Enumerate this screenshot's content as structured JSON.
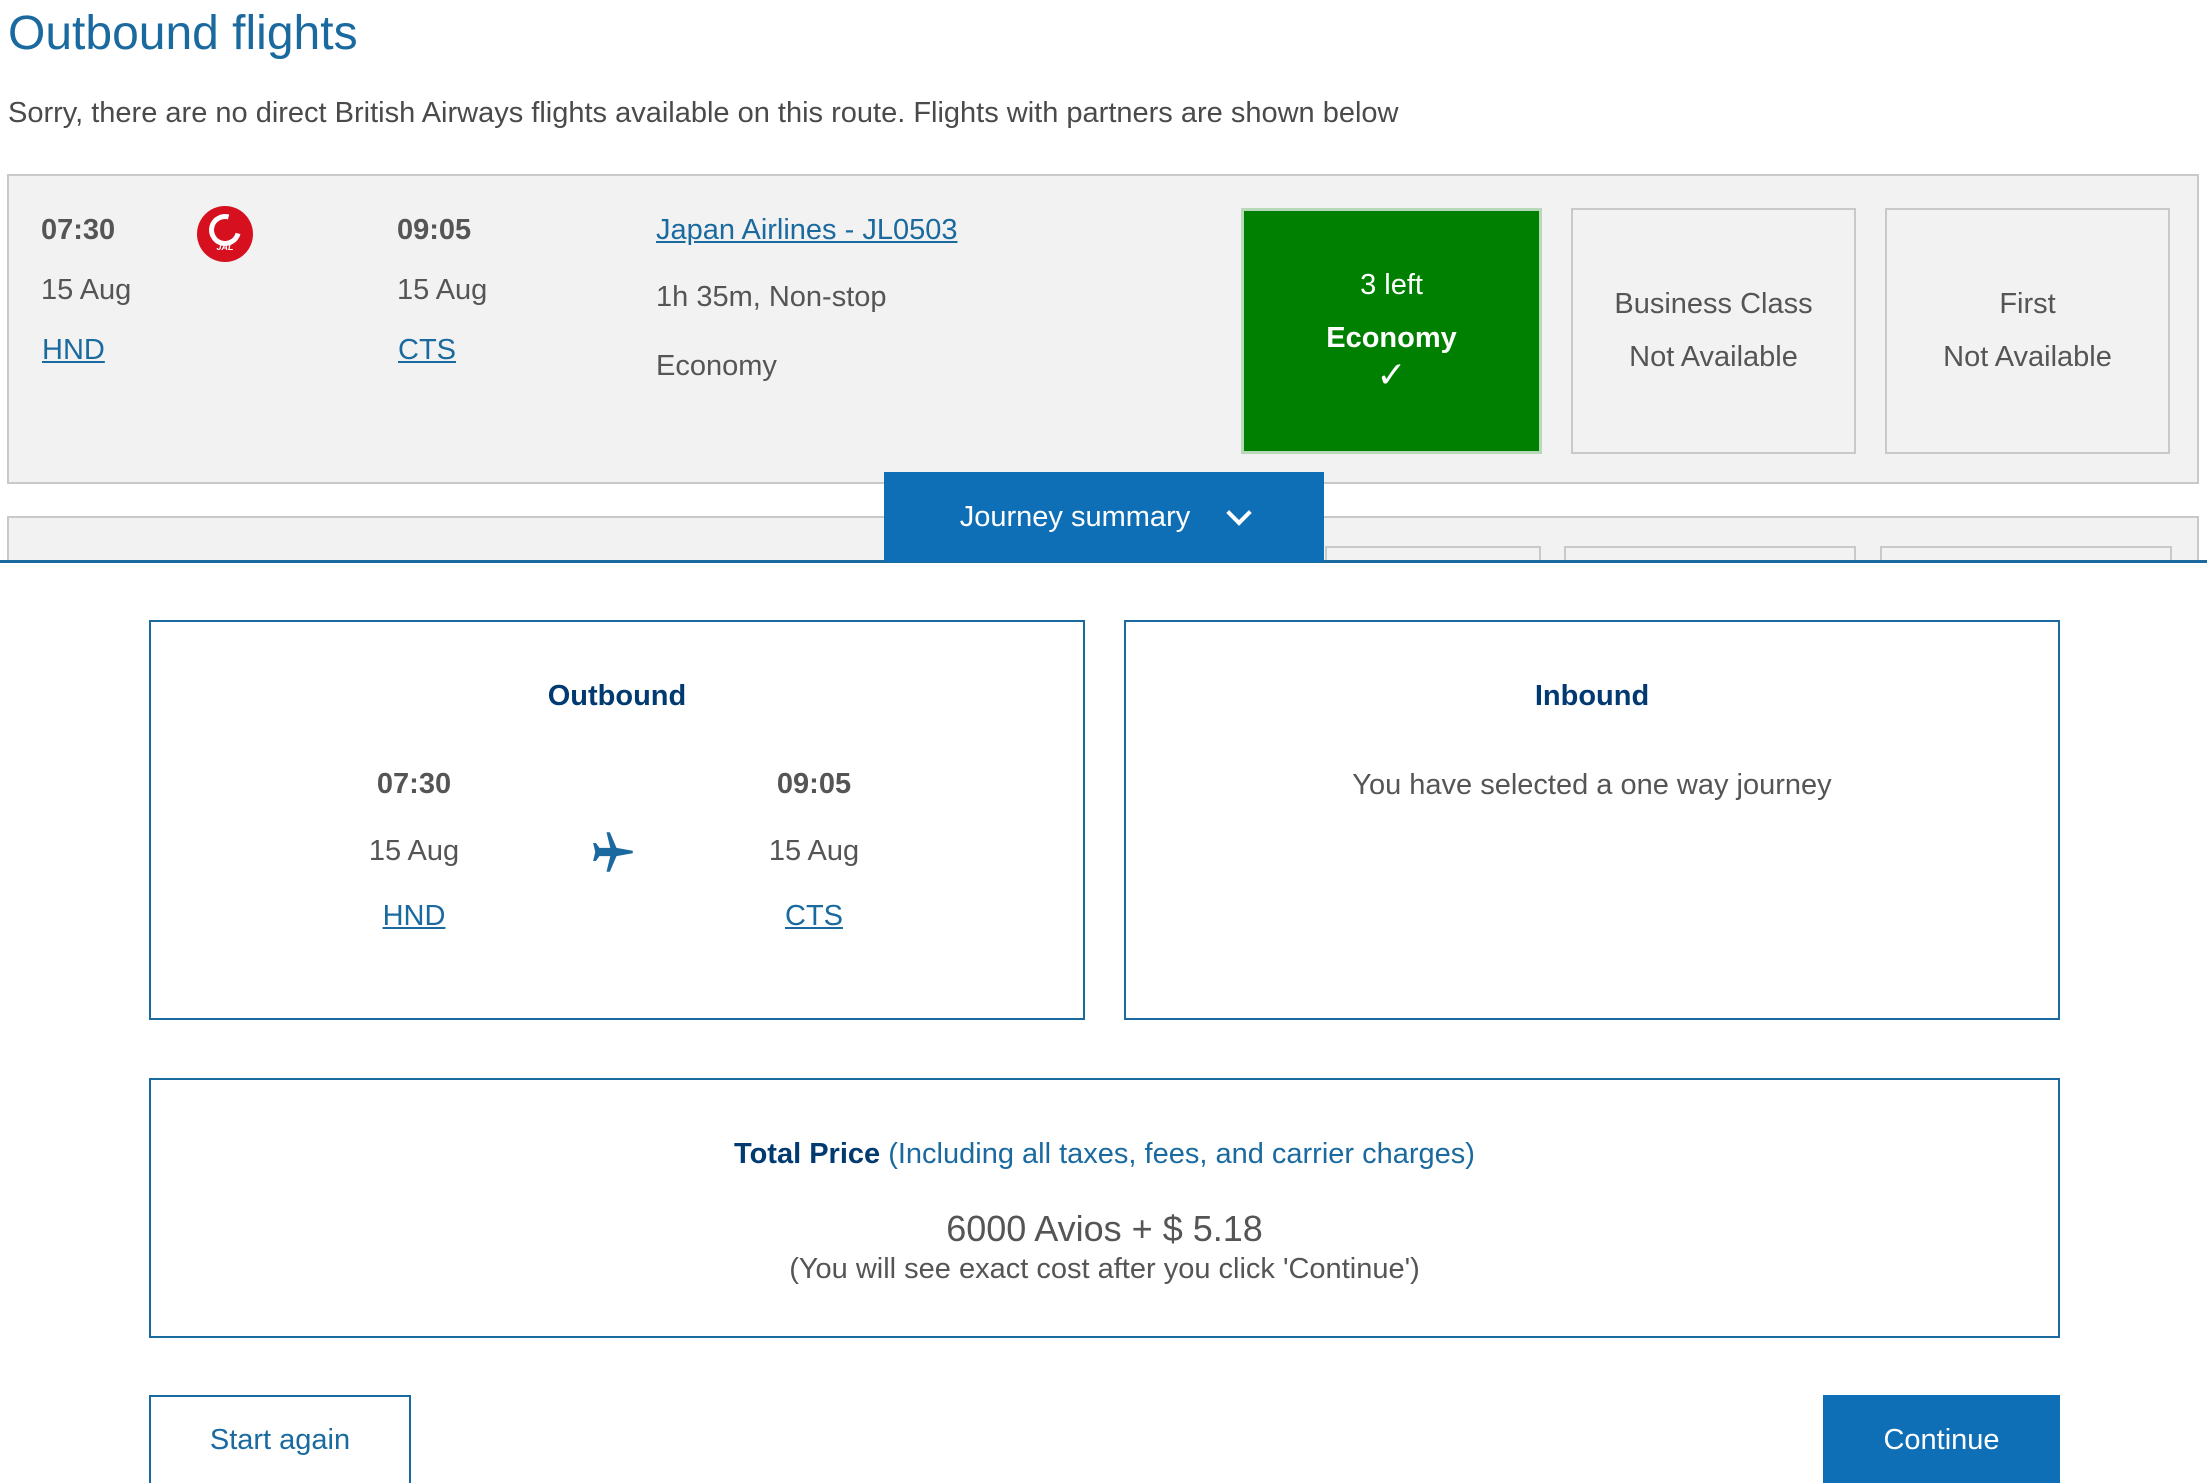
{
  "page": {
    "title": "Outbound flights",
    "notice": "Sorry, there are no direct British Airways flights available on this route. Flights with partners are shown below"
  },
  "flight": {
    "depart_time": "07:30",
    "depart_date": "15 Aug",
    "depart_airport": "HND",
    "arrive_time": "09:05",
    "arrive_date": "15 Aug",
    "arrive_airport": "CTS",
    "airline_link": "Japan Airlines - JL0503",
    "duration": "1h 35m, Non-stop",
    "cabin": "Economy",
    "airline_logo_text": "JAL",
    "economy": {
      "seats_left": "3 left",
      "label": "Economy",
      "check": "✓"
    },
    "business": {
      "label": "Business Class",
      "status": "Not Available"
    },
    "first": {
      "label": "First",
      "status": "Not Available"
    }
  },
  "summary_tab": {
    "label": "Journey summary"
  },
  "outbound": {
    "title": "Outbound",
    "depart_time": "07:30",
    "depart_date": "15 Aug",
    "depart_airport": "HND",
    "arrive_time": "09:05",
    "arrive_date": "15 Aug",
    "arrive_airport": "CTS"
  },
  "inbound": {
    "title": "Inbound",
    "message": "You have selected a one way journey"
  },
  "price": {
    "label": "Total Price",
    "qualifier": "(Including all taxes, fees, and carrier charges)",
    "amount": "6000 Avios + $ 5.18",
    "note": "(You will see exact cost after you click 'Continue')"
  },
  "buttons": {
    "start_again": "Start again",
    "continue": "Continue"
  },
  "colors": {
    "brand_blue": "#1a6aa0",
    "button_blue": "#0e6fb6",
    "selected_green": "#008000",
    "jal_red": "#d7101f"
  }
}
